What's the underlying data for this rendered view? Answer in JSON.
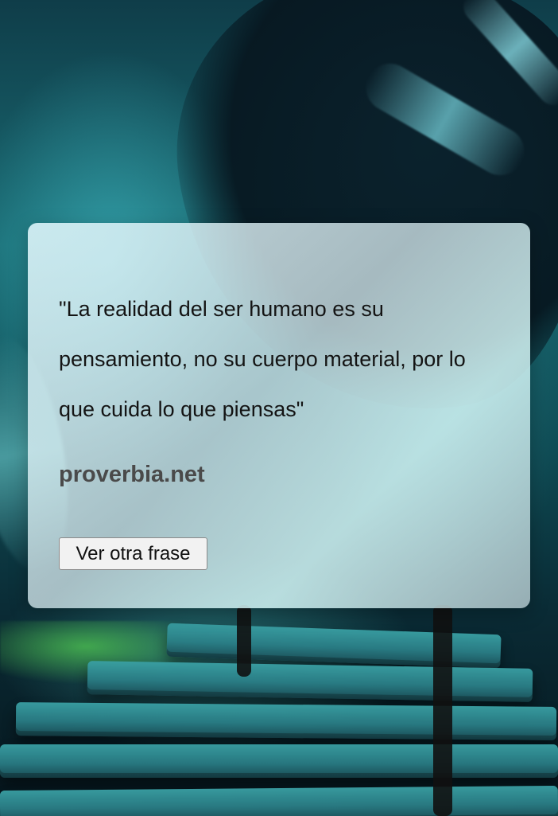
{
  "quote": {
    "text": "\"La realidad del ser humano es su pensamiento, no su cuerpo material, por lo que cuida lo que piensas\"",
    "source": "proverbia.net"
  },
  "actions": {
    "next_label": "Ver otra frase"
  },
  "colors": {
    "card_bg": "#dceff2",
    "quote_text": "#141414",
    "source_text": "#4a4a4a"
  }
}
